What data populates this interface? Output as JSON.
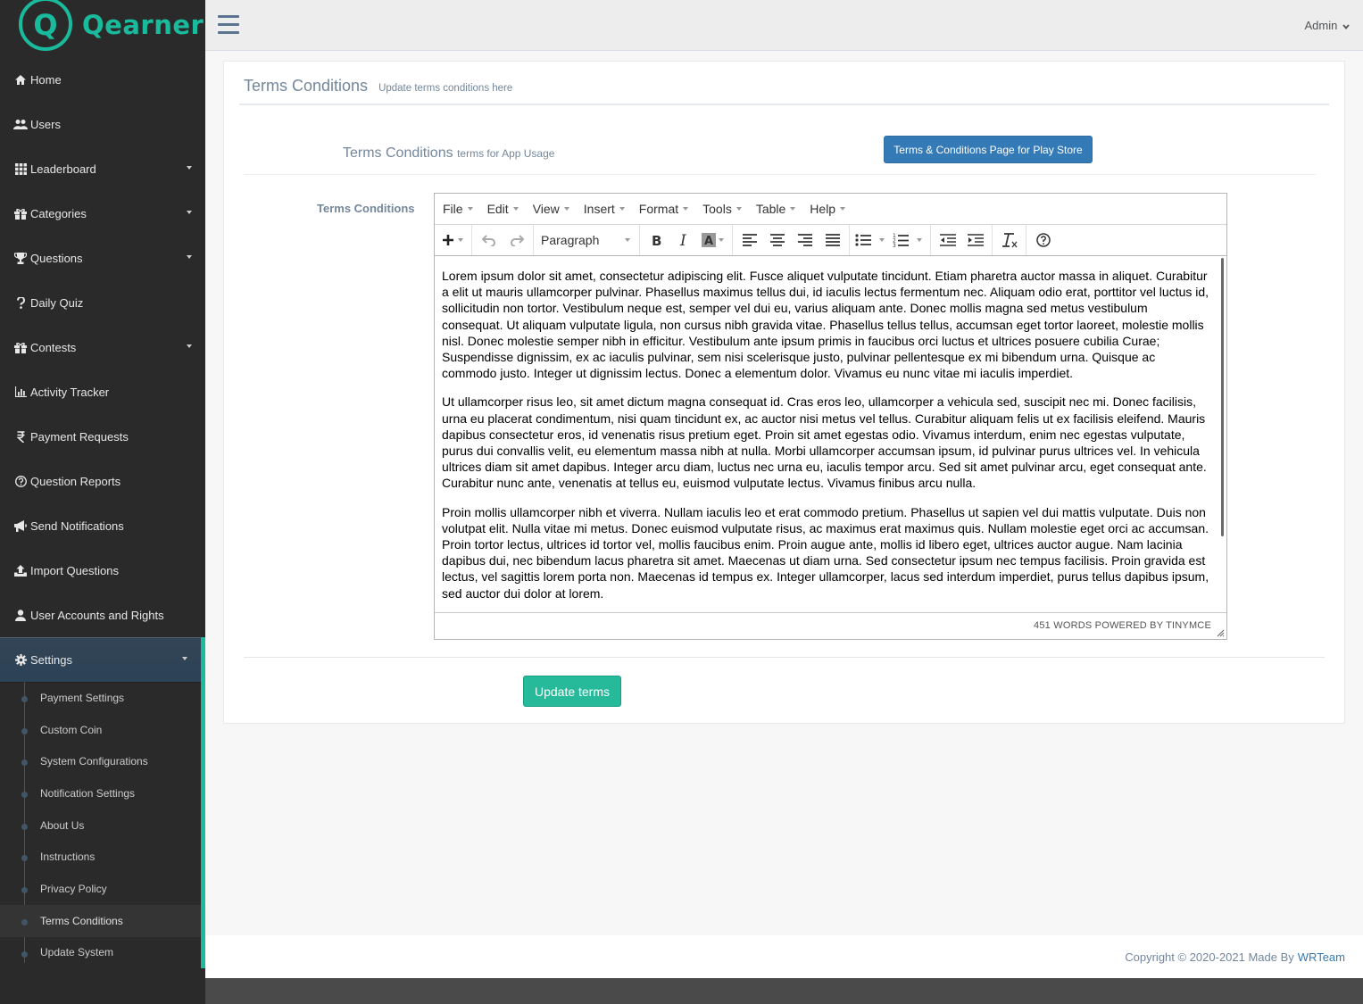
{
  "brand": {
    "logo_letter": "Q",
    "name": "Qearner",
    "accent": "#1abb9c"
  },
  "topbar": {
    "admin_label": "Admin"
  },
  "sidebar": {
    "items": [
      {
        "label": "Home",
        "icon": "home-icon",
        "caret": false
      },
      {
        "label": "Users",
        "icon": "users-icon",
        "caret": false
      },
      {
        "label": "Leaderboard",
        "icon": "grid-icon",
        "caret": true
      },
      {
        "label": "Categories",
        "icon": "gift-icon",
        "caret": true
      },
      {
        "label": "Questions",
        "icon": "trophy-icon",
        "caret": true
      },
      {
        "label": "Daily Quiz",
        "icon": "question-icon",
        "caret": false
      },
      {
        "label": "Contests",
        "icon": "gift-icon",
        "caret": true
      },
      {
        "label": "Activity Tracker",
        "icon": "bar-chart-icon",
        "caret": false
      },
      {
        "label": "Payment Requests",
        "icon": "rupee-icon",
        "caret": false
      },
      {
        "label": "Question Reports",
        "icon": "question-circle-icon",
        "caret": false
      },
      {
        "label": "Send Notifications",
        "icon": "bullhorn-icon",
        "caret": false
      },
      {
        "label": "Import Questions",
        "icon": "upload-icon",
        "caret": false
      },
      {
        "label": "User Accounts and Rights",
        "icon": "user-icon",
        "caret": false
      },
      {
        "label": "Settings",
        "icon": "gear-icon",
        "caret": true
      }
    ],
    "settings_sub": [
      "Payment Settings",
      "Custom Coin",
      "System Configurations",
      "Notification Settings",
      "About Us",
      "Instructions",
      "Privacy Policy",
      "Terms Conditions",
      "Update System"
    ],
    "current_sub": "Terms Conditions"
  },
  "panel": {
    "title": "Terms Conditions",
    "title_small": "Update terms conditions here",
    "subtitle": "Terms Conditions",
    "subtitle_small": "terms for App Usage",
    "play_store_button": "Terms & Conditions Page for Play Store",
    "field_label": "Terms Conditions",
    "update_button": "Update terms"
  },
  "editor": {
    "menus": [
      "File",
      "Edit",
      "View",
      "Insert",
      "Format",
      "Tools",
      "Table",
      "Help"
    ],
    "block_format": "Paragraph",
    "paragraphs": [
      "Lorem ipsum dolor sit amet, consectetur adipiscing elit. Fusce aliquet vulputate tincidunt. Etiam pharetra auctor massa in aliquet. Curabitur a elit ut mauris ullamcorper pulvinar. Phasellus maximus tellus dui, id iaculis lectus fermentum nec. Aliquam odio erat, porttitor vel luctus id, sollicitudin non tortor. Vestibulum neque est, semper vel dui eu, varius aliquam ante. Donec mollis magna sed metus vestibulum consequat. Ut aliquam vulputate ligula, non cursus nibh gravida vitae. Phasellus tellus tellus, accumsan eget tortor laoreet, molestie mollis nisl. Donec molestie semper nibh in efficitur. Vestibulum ante ipsum primis in faucibus orci luctus et ultrices posuere cubilia Curae; Suspendisse dignissim, ex ac iaculis pulvinar, sem nisi scelerisque justo, pulvinar pellentesque ex mi bibendum urna. Quisque ac commodo justo. Integer ut dignissim lectus. Donec a elementum dolor. Vivamus eu nunc vitae mi iaculis imperdiet.",
      "Ut ullamcorper risus leo, sit amet dictum magna consequat id. Cras eros leo, ullamcorper a vehicula sed, suscipit nec mi. Donec facilisis, urna eu placerat condimentum, nisi quam tincidunt ex, ac auctor nisi metus vel tellus. Curabitur aliquam felis ut ex facilisis eleifend. Mauris dapibus consectetur eros, id venenatis risus pretium eget. Proin sit amet egestas odio. Vivamus interdum, enim nec egestas vulputate, purus dui convallis velit, eu elementum massa nibh at nulla. Morbi ullamcorper accumsan ipsum, id pulvinar purus ultrices vel. In vehicula ultrices diam sit amet dapibus. Integer arcu diam, luctus nec urna eu, iaculis tempor arcu. Sed sit amet pulvinar arcu, eget consequat ante. Curabitur nunc ante, venenatis at tellus eu, euismod vulputate lectus. Vivamus finibus arcu nulla.",
      "Proin mollis ullamcorper nibh et viverra. Nullam iaculis leo et erat commodo pretium. Phasellus ut sapien vel dui mattis vulputate. Duis non volutpat elit. Nulla vitae mi metus. Donec euismod vulputate risus, ac maximus erat maximus quis. Nullam molestie eget orci ac accumsan. Proin tortor lectus, ultrices id tortor vel, mollis faucibus enim. Proin augue ante, mollis id libero eget, ultrices auctor augue. Nam lacinia dapibus dui, nec bibendum lacus pharetra sit amet. Maecenas ut diam urna. Sed consectetur ipsum nec tempus facilisis. Proin gravida est lectus, vel sagittis lorem porta non. Maecenas id tempus ex. Integer ullamcorper, lacus sed interdum imperdiet, purus tellus dapibus ipsum, sed auctor dui dolor at lorem."
    ],
    "status": "451 WORDS POWERED BY TINYMCE"
  },
  "footer": {
    "copyright": "Copyright © 2020-2021 Made By",
    "link": "WRTeam"
  }
}
